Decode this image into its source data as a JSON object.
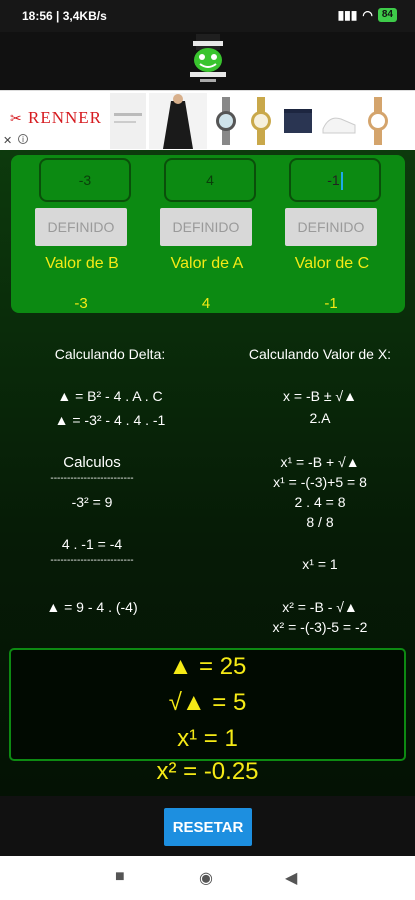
{
  "status_bar": {
    "time": "18:56",
    "network_speed": "3,4KB/s",
    "battery": "84"
  },
  "ad": {
    "brand": "RENNER",
    "close": "✕",
    "info": "i"
  },
  "inputs": [
    {
      "field_value": "-3",
      "button": "DEFINIDO",
      "label": "Valor de B",
      "value": "-3"
    },
    {
      "field_value": "4",
      "button": "DEFINIDO",
      "label": "Valor de A",
      "value": "4"
    },
    {
      "field_value": "-1",
      "button": "DEFINIDO",
      "label": "Valor de C",
      "value": "-1"
    }
  ],
  "delta_section": {
    "heading": "Calculando Delta:",
    "formula_1": "▲ = B² - 4 . A . C",
    "formula_2": "▲ = -3² - 4 . 4 . -1",
    "calculos_title": "Calculos",
    "separator_1": "-------------------------",
    "calc_1": "-3² = 9",
    "calc_2": "4 . -1 = -4",
    "separator_2": "-------------------------",
    "final": "▲ = 9 - 4 . (-4)"
  },
  "x_section": {
    "heading": "Calculando Valor de X:",
    "formula_1": "x = -B ± √▲",
    "formula_2": "2.A",
    "x1_formula": "x¹ = -B + √▲",
    "x1_sub": "x¹ = -(-3)+5 = 8",
    "x1_den": "2 . 4 = 8",
    "x1_frac": "8 / 8",
    "x1_result": "x¹ = 1",
    "x2_formula": "x² = -B - √▲",
    "x2_sub": "x² = -(-3)-5 = -2"
  },
  "results": {
    "delta": "▲ = 25",
    "sqrt_delta": "√▲ = 5",
    "x1": "x¹ = 1",
    "x2": "x² = -0.25"
  },
  "reset_label": "RESETAR",
  "nav": {
    "recents": "■",
    "home": "◉",
    "back": "◀"
  }
}
